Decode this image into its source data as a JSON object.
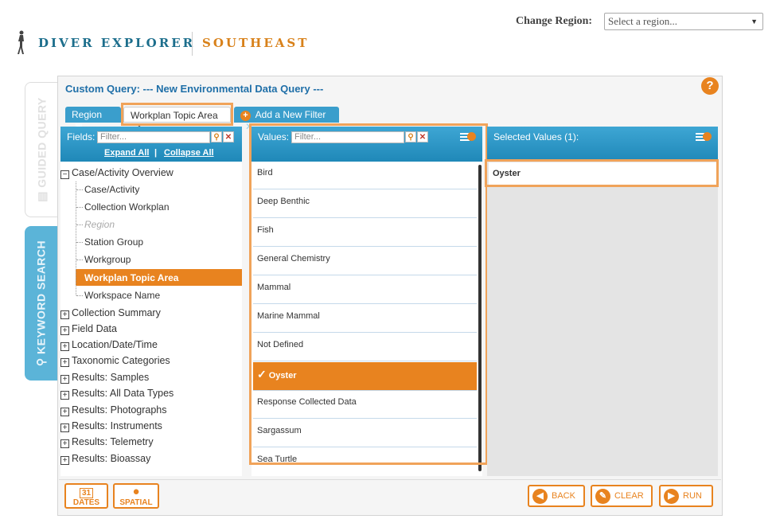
{
  "header": {
    "change_region_label": "Change Region:",
    "region_select_value": "Select a region...",
    "brand_left": "DIVER EXPLORER",
    "brand_right": "SOUTHEAST"
  },
  "side_tabs": {
    "guided": "GUIDED QUERY",
    "keyword": "KEYWORD SEARCH"
  },
  "panel": {
    "title": "Custom Query: --- New Environmental Data Query ---",
    "help": "?"
  },
  "filter_tabs": {
    "region": "Region",
    "workplan": "Workplan Topic Area",
    "add": "Add a New Filter"
  },
  "fields": {
    "label": "Fields:",
    "filter_placeholder": "Filter...",
    "expand_all": "Expand All",
    "separator": "|",
    "collapse_all": "Collapse All",
    "tree": {
      "case_activity_overview": "Case/Activity Overview",
      "children": [
        "Case/Activity",
        "Collection Workplan",
        "Region",
        "Station Group",
        "Workgroup",
        "Workplan Topic Area",
        "Workspace Name"
      ],
      "groups": [
        "Collection Summary",
        "Field Data",
        "Location/Date/Time",
        "Taxonomic Categories",
        "Results: Samples",
        "Results: All Data Types",
        "Results: Photographs",
        "Results: Instruments",
        "Results: Telemetry",
        "Results: Bioassay"
      ]
    }
  },
  "values": {
    "label": "Values:",
    "filter_placeholder": "Filter...",
    "items": [
      "Bird",
      "Deep Benthic",
      "Fish",
      "General Chemistry",
      "Mammal",
      "Marine Mammal",
      "Not Defined",
      "Oyster",
      "Response Collected Data",
      "Sargassum",
      "Sea Turtle"
    ]
  },
  "selected": {
    "label": "Selected Values (1):",
    "items": [
      "Oyster"
    ]
  },
  "toolbar": {
    "dates": "DATES",
    "dates_day": "31",
    "spatial": "SPATIAL",
    "back": "BACK",
    "clear": "CLEAR",
    "run": "RUN"
  },
  "colors": {
    "accent": "#e8831f",
    "header_blue": "#2a95c4",
    "title_blue": "#1f6fa8"
  }
}
